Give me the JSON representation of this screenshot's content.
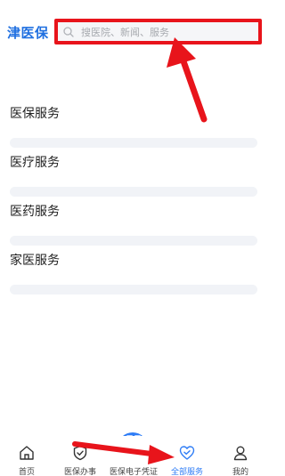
{
  "header": {
    "logo_text": "津医保",
    "search_placeholder": "搜医院、新闻、服务"
  },
  "sections": [
    {
      "title": "医保服务"
    },
    {
      "title": "医疗服务"
    },
    {
      "title": "医药服务"
    },
    {
      "title": "家医服务"
    }
  ],
  "tabbar": {
    "tabs": [
      {
        "label": "首页",
        "icon": "home-icon"
      },
      {
        "label": "医保办事",
        "icon": "shield-check-icon"
      },
      {
        "label": "医保电子凭证",
        "icon": "qr-code-icon"
      },
      {
        "label": "全部服务",
        "icon": "heart-check-icon",
        "active": true
      },
      {
        "label": "我的",
        "icon": "user-icon"
      }
    ]
  },
  "colors": {
    "brand_blue": "#1f6fe0",
    "active_tab": "#2f7df6",
    "annotation_red": "#e8141b"
  }
}
